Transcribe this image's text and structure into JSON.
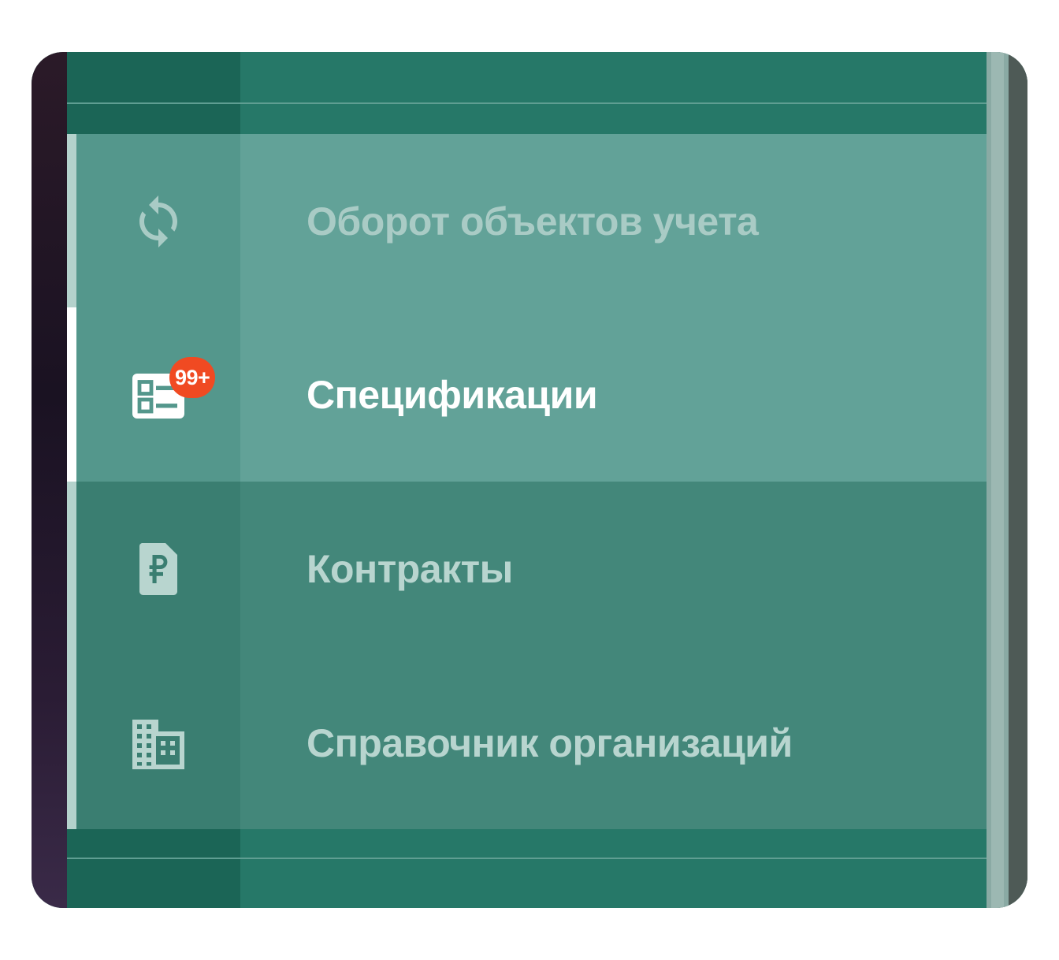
{
  "menu": {
    "items": [
      {
        "label": "Оборот объектов учета",
        "icon": "sync-icon",
        "selected": false
      },
      {
        "label": "Спецификации",
        "icon": "spec-list-icon",
        "selected": true,
        "badge": "99+"
      },
      {
        "label": "Контракты",
        "icon": "ruble-document-icon",
        "selected": false
      },
      {
        "label": "Справочник организаций",
        "icon": "building-icon",
        "selected": false
      }
    ]
  },
  "colors": {
    "panel": "#2a7a6c",
    "item_light": "#62a298",
    "item_dark": "#43877a",
    "badge": "#f04a22",
    "label_selected": "#ffffff",
    "label_muted": "#a9cbc5"
  }
}
